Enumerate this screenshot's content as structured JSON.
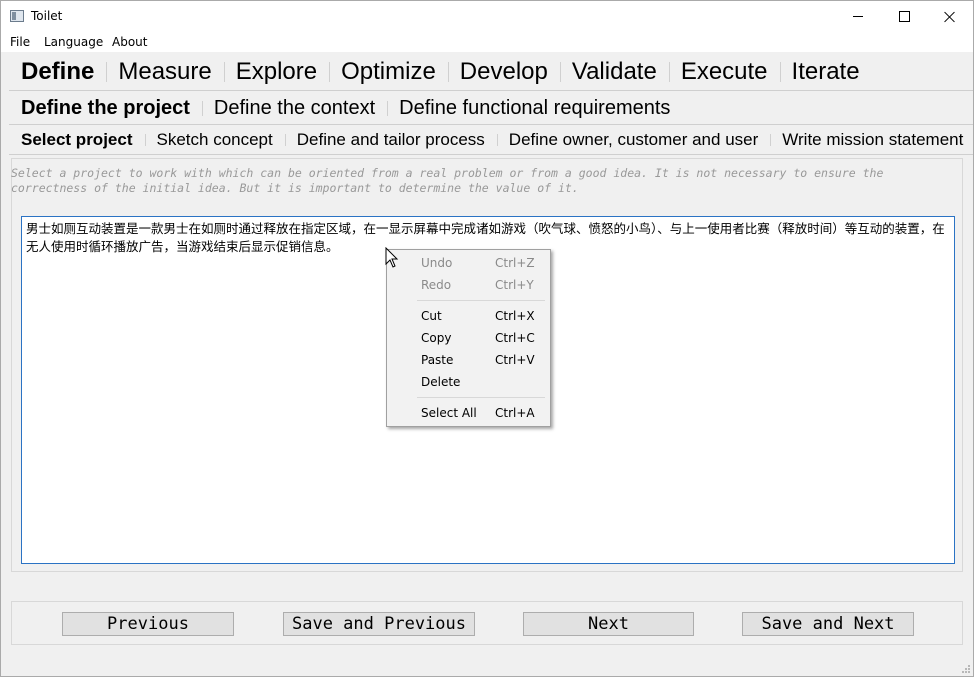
{
  "window": {
    "title": "Toilet"
  },
  "menubar": {
    "items": [
      "File",
      "Language",
      "About"
    ]
  },
  "main_tabs": [
    "Define",
    "Measure",
    "Explore",
    "Optimize",
    "Develop",
    "Validate",
    "Execute",
    "Iterate"
  ],
  "sub_tabs": [
    "Define the project",
    "Define the context",
    "Define functional requirements"
  ],
  "step_tabs": [
    "Select project",
    "Sketch concept",
    "Define and tailor process",
    "Define owner, customer and user",
    "Write mission statement"
  ],
  "hint": "Select a project to work with which can be oriented from a real problem or from a good idea. It is not necessary to ensure the correctness of the initial idea. But it is important to determine the value of it.",
  "editor": {
    "text": "男士如厕互动装置是一款男士在如厕时通过释放在指定区域，在一显示屏幕中完成诸如游戏（吹气球、愤怒的小鸟）、与上一使用者比赛（释放时间）等互动的装置，在无人使用时循环播放广告，当游戏结束后显示促销信息。"
  },
  "context_menu": {
    "undo": {
      "label": "Undo",
      "shortcut": "Ctrl+Z"
    },
    "redo": {
      "label": "Redo",
      "shortcut": "Ctrl+Y"
    },
    "cut": {
      "label": "Cut",
      "shortcut": "Ctrl+X"
    },
    "copy": {
      "label": "Copy",
      "shortcut": "Ctrl+C"
    },
    "paste": {
      "label": "Paste",
      "shortcut": "Ctrl+V"
    },
    "delete": {
      "label": "Delete"
    },
    "select_all": {
      "label": "Select All",
      "shortcut": "Ctrl+A"
    }
  },
  "buttons": {
    "previous": "Previous",
    "save_previous": "Save and Previous",
    "next": "Next",
    "save_next": "Save and Next"
  }
}
